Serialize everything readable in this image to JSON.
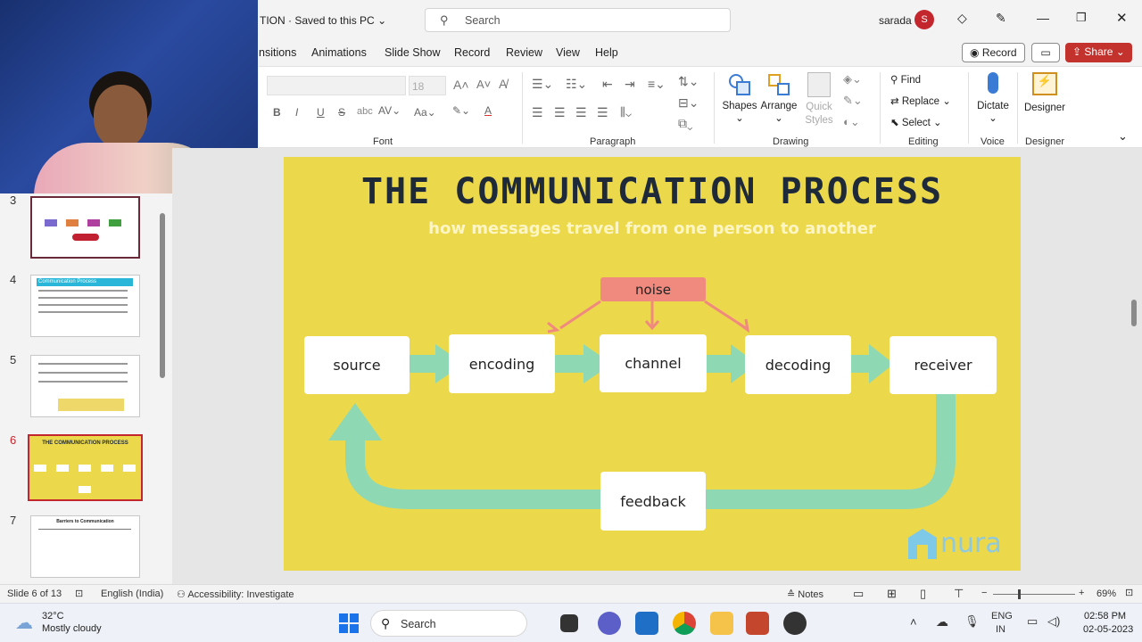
{
  "title": {
    "doc_name": "TION",
    "save_state": "· Saved to this PC",
    "search_placeholder": "Search",
    "user_name": "sarada",
    "avatar_initial": "S"
  },
  "tabs": [
    "nsitions",
    "Animations",
    "Slide Show",
    "Record",
    "Review",
    "View",
    "Help"
  ],
  "record_btn": "Record",
  "share_btn": "Share",
  "ribbon": {
    "font_name": "",
    "font_size": "18",
    "font_label": "Font",
    "paragraph_label": "Paragraph",
    "drawing_label": "Drawing",
    "editing_label": "Editing",
    "voice_label": "Voice",
    "designer_label": "Designer",
    "shapes": "Shapes",
    "arrange": "Arrange",
    "quick_styles": "Quick Styles",
    "find": "Find",
    "replace": "Replace",
    "select": "Select",
    "dictate": "Dictate",
    "designer": "Designer"
  },
  "thumbnails": [
    {
      "num": "3"
    },
    {
      "num": "4",
      "title": "Communication Process"
    },
    {
      "num": "5"
    },
    {
      "num": "6",
      "title": "THE COMMUNICATION PROCESS"
    },
    {
      "num": "7",
      "title": "Barriers to Communication"
    }
  ],
  "slide": {
    "title": "THE COMMUNICATION PROCESS",
    "subtitle": "how messages travel from one person to another",
    "noise": "noise",
    "source": "source",
    "encoding": "encoding",
    "channel": "channel",
    "decoding": "decoding",
    "receiver": "receiver",
    "feedback": "feedback",
    "logo": "nura",
    "colors": {
      "bg": "#ebd84b",
      "title": "#1e2a3a",
      "noise": "#f08a7e",
      "arrow": "#8fd8b4"
    }
  },
  "status": {
    "slide_info": "Slide 6 of 13",
    "language": "English (India)",
    "accessibility": "Accessibility: Investigate",
    "notes": "Notes",
    "zoom": "69%"
  },
  "taskbar": {
    "weather_temp": "32°C",
    "weather_desc": "Mostly cloudy",
    "search": "Search",
    "lang1": "ENG",
    "lang2": "IN",
    "time": "02:58 PM",
    "date": "02-05-2023"
  }
}
